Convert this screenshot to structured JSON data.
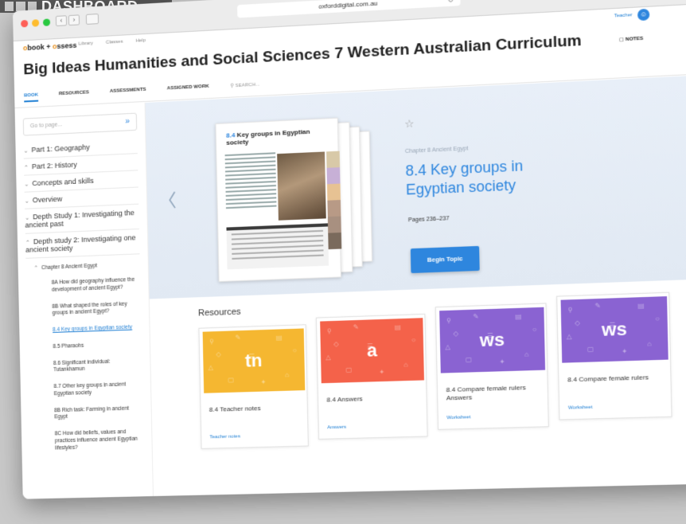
{
  "badge": "DASHBOARD",
  "browser": {
    "url": "oxforddigital.com.au"
  },
  "header": {
    "brand_prefix": "o",
    "brand_rest": "book + ",
    "brand_o2": "o",
    "brand_end": "ssess",
    "links": [
      "Library",
      "Classes",
      "Help"
    ],
    "user": "Teacher",
    "title": "Big Ideas Humanities and Social Sciences 7 Western Australian Curriculum",
    "notes": "NOTES",
    "tabs": [
      "BOOK",
      "RESOURCES",
      "ASSESSMENTS",
      "ASSIGNED WORK"
    ],
    "search_placeholder": "SEARCH..."
  },
  "sidebar": {
    "goto_placeholder": "Go to page...",
    "top_items": [
      {
        "arrow": "v",
        "label": "Part 1: Geography"
      },
      {
        "arrow": "^",
        "label": "Part 2: History"
      },
      {
        "arrow": "v",
        "label": "Concepts and skills"
      },
      {
        "arrow": "v",
        "label": "Overview"
      },
      {
        "arrow": "v",
        "label": "Depth Study 1: Investigating the ancient past"
      },
      {
        "arrow": "^",
        "label": "Depth study 2: Investigating one ancient society"
      }
    ],
    "chapter": "Chapter 8 Ancient Egypt",
    "sub_items": [
      "8A How did geography influence the development of ancient Egypt?",
      "8B What shaped the roles of key groups in ancient Egypt?",
      "8.4 Key groups in Egyptian society",
      "8.5 Pharaohs",
      "8.6 Significant individual: Tutankhamun",
      "8.7 Other key groups in ancient Egyptian society",
      "8B Rich task: Farming in ancient Egypt",
      "8C How did beliefs, values and practices influence ancient Egyptian lifestyles?"
    ],
    "active_index": 2
  },
  "hero": {
    "page_num": "8.4",
    "page_title": "Key groups in Egyptian society",
    "chapter": "Chapter 8 Ancient Egypt",
    "title": "8.4 Key groups in Egyptian society",
    "pages": "Pages 236–237",
    "button": "Begin Topic"
  },
  "resources": {
    "title": "Resources",
    "cards": [
      {
        "badge": "tn",
        "title": "8.4 Teacher notes",
        "type": "Teacher notes",
        "color": "#f5b731"
      },
      {
        "badge": "a",
        "title": "8.4 Answers",
        "type": "Answers",
        "color": "#f4624a"
      },
      {
        "badge": "ws",
        "title": "8.4 Compare female rulers Answers",
        "type": "Worksheet",
        "color": "#8a63d2"
      },
      {
        "badge": "ws",
        "title": "8.4 Compare female rulers",
        "type": "Worksheet",
        "color": "#8a63d2"
      }
    ]
  },
  "colors": {
    "accent": "#2e86de",
    "hero_bg": "#e8eff8"
  }
}
